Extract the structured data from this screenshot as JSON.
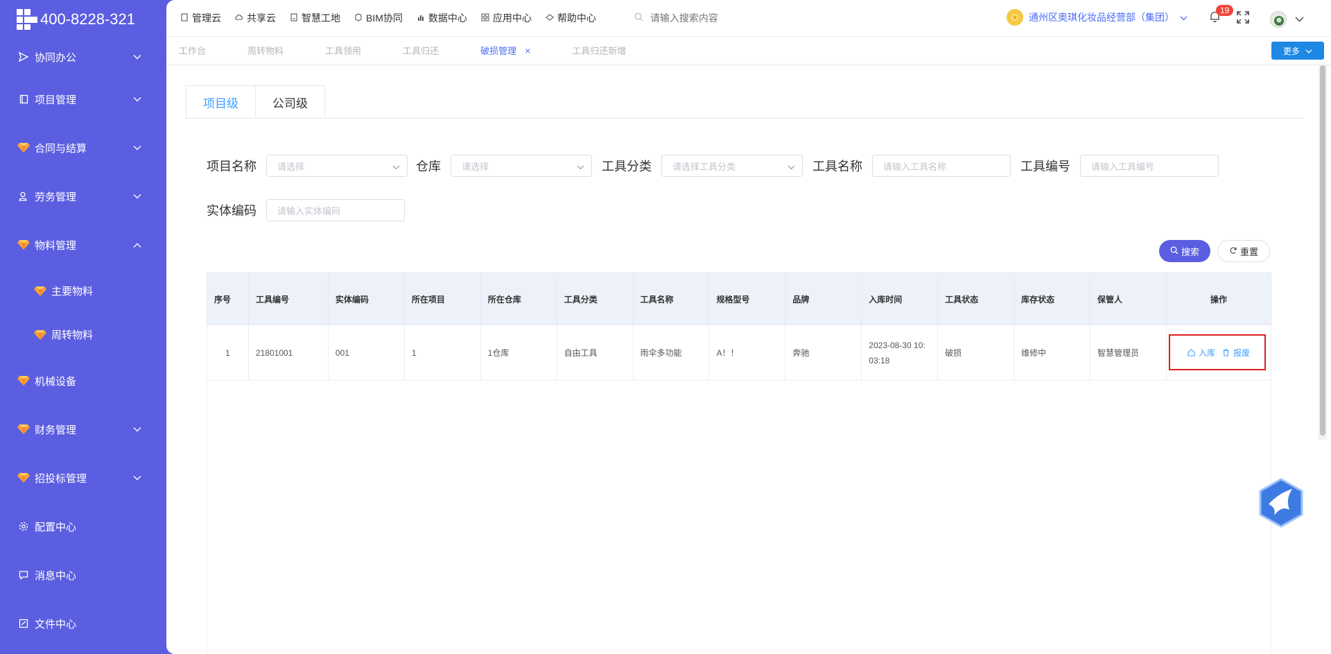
{
  "sidebar": {
    "phone": "400-8228-321",
    "items": [
      {
        "label": "协同办公",
        "icon": "send-icon",
        "expandable": true
      },
      {
        "label": "项目管理",
        "icon": "book-icon",
        "expandable": true
      },
      {
        "label": "合同与结算",
        "icon": "gem-icon",
        "expandable": true
      },
      {
        "label": "劳务管理",
        "icon": "users-icon",
        "expandable": true
      },
      {
        "label": "物料管理",
        "icon": "gem-icon",
        "expandable": true,
        "expanded": true
      },
      {
        "label": "主要物料",
        "icon": "gem-icon",
        "sub": true
      },
      {
        "label": "周转物料",
        "icon": "gem-icon",
        "sub": true
      },
      {
        "label": "机械设备",
        "icon": "gem-icon",
        "expandable": false
      },
      {
        "label": "财务管理",
        "icon": "gem-icon",
        "expandable": true
      },
      {
        "label": "招投标管理",
        "icon": "gem-icon",
        "expandable": true
      },
      {
        "label": "配置中心",
        "icon": "gear-icon",
        "expandable": false
      },
      {
        "label": "消息中心",
        "icon": "message-icon",
        "expandable": false
      },
      {
        "label": "文件中心",
        "icon": "file-icon",
        "expandable": false
      }
    ]
  },
  "topnav": {
    "items": [
      {
        "label": "管理云",
        "icon": "doc-icon"
      },
      {
        "label": "共享云",
        "icon": "cloud-icon"
      },
      {
        "label": "智慧工地",
        "icon": "doc-icon"
      },
      {
        "label": "BIM协同",
        "icon": "cube-icon"
      },
      {
        "label": "数据中心",
        "icon": "chart-icon"
      },
      {
        "label": "应用中心",
        "icon": "grid-icon"
      },
      {
        "label": "帮助中心",
        "icon": "help-icon"
      }
    ],
    "search_placeholder": "请输入搜索内容",
    "org": "通州区奥琪化妆品经营部（集团）",
    "notification_count": "19"
  },
  "tabs": [
    {
      "label": "工作台",
      "active": false
    },
    {
      "label": "周转物料",
      "active": false
    },
    {
      "label": "工具领用",
      "active": false
    },
    {
      "label": "工具归还",
      "active": false
    },
    {
      "label": "破损管理",
      "active": true,
      "closable": true
    },
    {
      "label": "工具归还新增",
      "active": false
    }
  ],
  "more_label": "更多",
  "subtabs": [
    "项目级",
    "公司级"
  ],
  "filters": {
    "project_name": {
      "label": "项目名称",
      "placeholder": "请选择"
    },
    "warehouse": {
      "label": "仓库",
      "placeholder": "请选择"
    },
    "tool_category": {
      "label": "工具分类",
      "placeholder": "请选择工具分类"
    },
    "tool_name": {
      "label": "工具名称",
      "placeholder": "请输入工具名称"
    },
    "tool_code": {
      "label": "工具编号",
      "placeholder": "请输入工具编号"
    },
    "entity_code": {
      "label": "实体编码",
      "placeholder": "请输入实体编码"
    }
  },
  "buttons": {
    "search": "搜索",
    "reset": "重置"
  },
  "table": {
    "headers": [
      "序号",
      "工具编号",
      "实体编码",
      "所在项目",
      "所在仓库",
      "工具分类",
      "工具名称",
      "规格型号",
      "品牌",
      "入库时间",
      "工具状态",
      "库存状态",
      "保管人",
      "操作"
    ],
    "rows": [
      {
        "index": "1",
        "tool_code": "21801001",
        "entity_code": "001",
        "project": "1",
        "warehouse": "1仓库",
        "category": "自由工具",
        "name": "雨伞多功能",
        "spec": "A！！",
        "brand": "奔驰",
        "in_time_1": "2023-08-30 10:",
        "in_time_2": "03:18",
        "tool_status": "破损",
        "stock_status": "维修中",
        "keeper": "智慧管理员",
        "op_in": "入库",
        "op_scrap": "报废"
      }
    ]
  },
  "colors": {
    "sidebar": "#5b5ee0",
    "accent": "#409eff",
    "highlight": "#e01c1c",
    "more_button": "#1e88e5"
  }
}
